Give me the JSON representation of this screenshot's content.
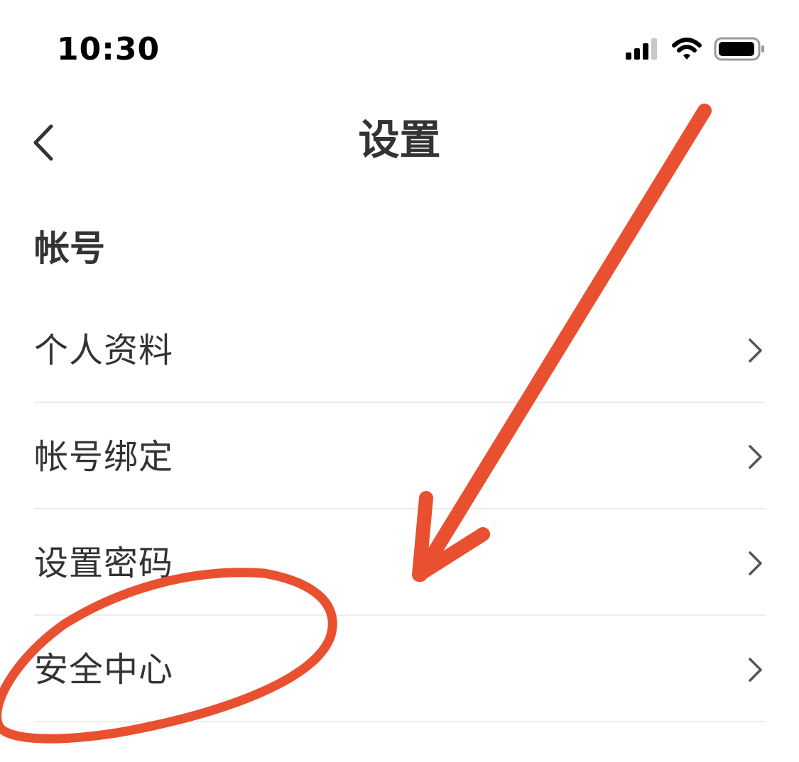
{
  "status_bar": {
    "time": "10:30",
    "icons": [
      "signal-icon",
      "wifi-icon",
      "battery-icon"
    ]
  },
  "nav": {
    "title": "设置",
    "back_icon": "chevron-left-icon"
  },
  "account_section": {
    "header": "帐号",
    "items": [
      {
        "label": "个人资料",
        "icon": "chevron-right-icon"
      },
      {
        "label": "帐号绑定",
        "icon": "chevron-right-icon"
      },
      {
        "label": "设置密码",
        "icon": "chevron-right-icon"
      },
      {
        "label": "安全中心",
        "icon": "chevron-right-icon"
      }
    ]
  },
  "annotation": {
    "color": "#E8502F",
    "shapes": [
      "arrow",
      "ellipse"
    ]
  },
  "colors": {
    "text_primary": "#333333",
    "divider": "#ececec",
    "chevron": "#555555"
  }
}
